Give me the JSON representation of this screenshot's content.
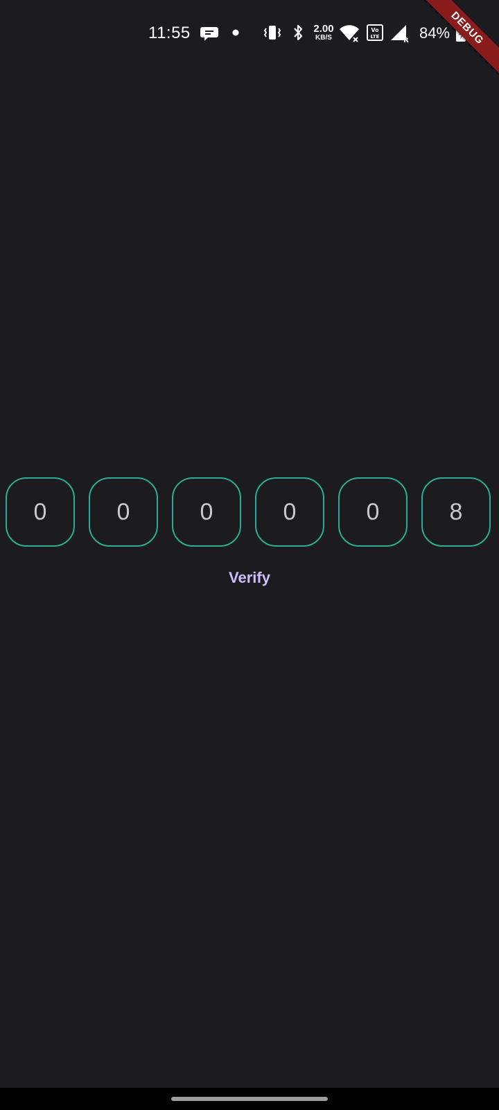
{
  "status_bar": {
    "time": "11:55",
    "net_speed_value": "2.00",
    "net_speed_unit": "KB/S",
    "battery_percent": "84%",
    "icons": [
      "chat-bubble-icon",
      "notification-dot-icon",
      "vibrate-icon",
      "bluetooth-icon",
      "wifi-icon",
      "volte-icon",
      "signal-icon",
      "battery-icon"
    ]
  },
  "debug_banner": "DEBUG",
  "otp": {
    "digits": [
      "0",
      "0",
      "0",
      "0",
      "0",
      "8"
    ]
  },
  "verify_label": "Verify",
  "colors": {
    "background": "#1c1b20",
    "otp_border": "#2bae91",
    "otp_text": "#c9c7cf",
    "verify_text": "#cfbdfe",
    "debug_ribbon": "#8b1c1c"
  }
}
